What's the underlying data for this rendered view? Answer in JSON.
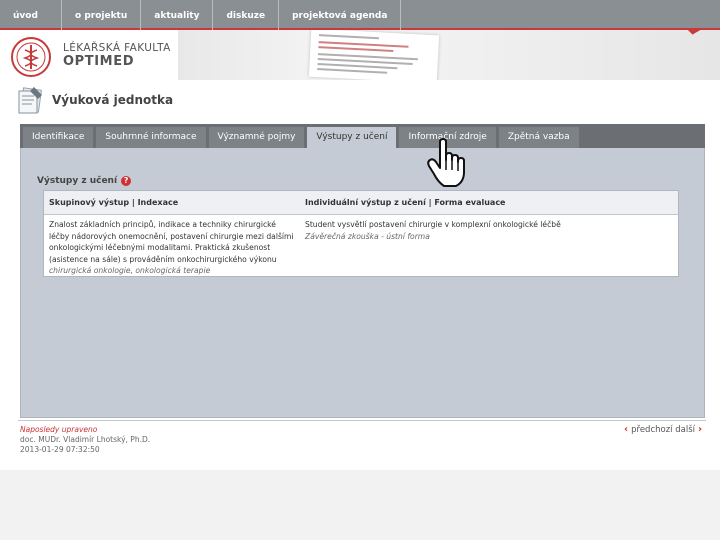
{
  "nav": {
    "items": [
      "úvod",
      "o projektu",
      "aktuality",
      "diskuze",
      "projektová agenda"
    ]
  },
  "header": {
    "logo_line1": "LÉKAŘSKÁ FAKULTA",
    "logo_line2": "OPTIMED"
  },
  "page": {
    "title": "Výuková jednotka"
  },
  "tabs": [
    {
      "label": "Identifikace",
      "active": false
    },
    {
      "label": "Souhrnné informace",
      "active": false
    },
    {
      "label": "Významné pojmy",
      "active": false
    },
    {
      "label": "Výstupy z učení",
      "active": true
    },
    {
      "label": "Informační zdroje",
      "active": false
    },
    {
      "label": "Zpětná vazba",
      "active": false
    }
  ],
  "section": {
    "title": "Výstupy z učení",
    "help_glyph": "?"
  },
  "table": {
    "headers": [
      "Skupinový výstup | Indexace",
      "Individuální výstup z učení | Forma evaluace"
    ],
    "rows": [
      {
        "group_text": "Znalost základních principů, indikace a techniky chirurgické léčby nádorových onemocnění, postavení chirurgie mezi dalšími onkologickými léčebnými modalitami. Praktická zkušenost (asistence na sále) s prováděním onkochirurgického výkonu",
        "group_index": "chirurgická onkologie, onkologická terapie",
        "individual_text": "Student vysvětlí postavení chirurgie v komplexní onkologické léčbě",
        "evaluation": "Závěrečná zkouška - ústní forma"
      }
    ]
  },
  "footer": {
    "last_modified_label": "Naposledy upraveno",
    "author": "doc. MUDr. Vladimír Lhotský, Ph.D.",
    "date": "2013-01-29 07:32:50",
    "pager": "předchozí   další"
  },
  "colors": {
    "accent_red": "#c63a3a",
    "nav_bg": "#8a8f94",
    "tab_bar": "#6b6f74",
    "panel_bg": "#c4cbd4"
  }
}
